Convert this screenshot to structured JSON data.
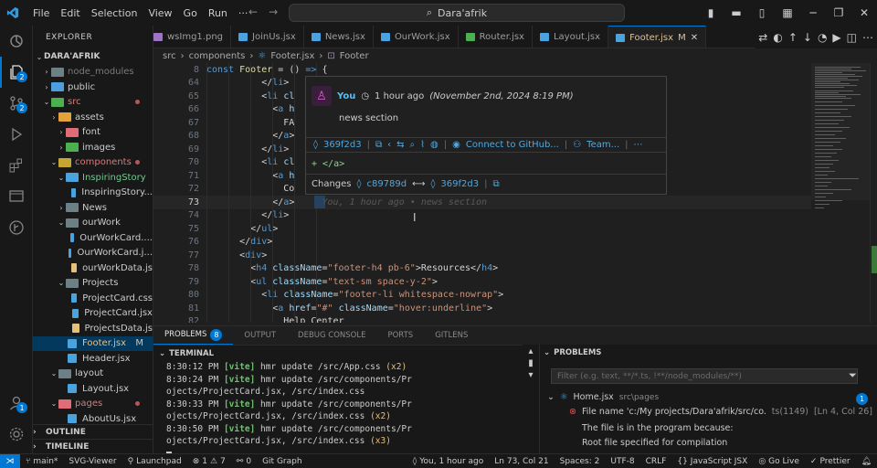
{
  "titlebar": {
    "menu": [
      "File",
      "Edit",
      "Selection",
      "View",
      "Go",
      "Run"
    ],
    "more": "···",
    "search": "Dara'afrik"
  },
  "activity": [
    {
      "icon": "vscode-logo-icon"
    },
    {
      "icon": "explorer-icon",
      "badge": "2"
    },
    {
      "icon": "source-control-icon",
      "badge": "2"
    },
    {
      "icon": "run-debug-icon"
    },
    {
      "icon": "extensions-icon"
    },
    {
      "icon": "remote-explorer-icon"
    },
    {
      "icon": "gitlens-icon"
    },
    {
      "icon": "accounts-icon",
      "badge": "1"
    },
    {
      "icon": "settings-gear-icon"
    }
  ],
  "sidebar": {
    "title": "EXPLORER",
    "root": "DARA'AFRIK",
    "items": [
      {
        "label": "node_modules",
        "indent": 1,
        "type": "folder",
        "open": false,
        "color": "#6d8086",
        "dim": true
      },
      {
        "label": "public",
        "indent": 1,
        "type": "folder",
        "open": false,
        "color": "#4d9de0"
      },
      {
        "label": "src",
        "indent": 1,
        "type": "folder",
        "open": true,
        "color": "#4caf50",
        "dot": true,
        "labelColor": "#d97a7a"
      },
      {
        "label": "assets",
        "indent": 2,
        "type": "folder",
        "open": false,
        "color": "#e5a23a"
      },
      {
        "label": "font",
        "indent": 3,
        "type": "folder",
        "open": false,
        "color": "#e06c75"
      },
      {
        "label": "images",
        "indent": 3,
        "type": "folder",
        "open": false,
        "color": "#4caf50"
      },
      {
        "label": "components",
        "indent": 2,
        "type": "folder",
        "open": true,
        "color": "#c5a632",
        "dot": true,
        "labelColor": "#d97a7a"
      },
      {
        "label": "InspiringStory",
        "indent": 3,
        "type": "folder",
        "open": true,
        "color": "#4aa3df",
        "labelColor": "#73c991"
      },
      {
        "label": "InspiringStory...",
        "indent": 4,
        "type": "file",
        "color": "#4aa3df"
      },
      {
        "label": "News",
        "indent": 3,
        "type": "folder",
        "open": false,
        "color": "#6d8086"
      },
      {
        "label": "ourWork",
        "indent": 3,
        "type": "folder",
        "open": true,
        "color": "#6d8086"
      },
      {
        "label": "OurWorkCard....",
        "indent": 4,
        "type": "file",
        "color": "#4aa3df"
      },
      {
        "label": "OurWorkCard.j...",
        "indent": 4,
        "type": "file",
        "color": "#4aa3df"
      },
      {
        "label": "ourWorkData.js",
        "indent": 4,
        "type": "file",
        "color": "#e5c07b"
      },
      {
        "label": "Projects",
        "indent": 3,
        "type": "folder",
        "open": true,
        "color": "#6d8086"
      },
      {
        "label": "ProjectCard.css",
        "indent": 4,
        "type": "file",
        "color": "#4aa3df"
      },
      {
        "label": "ProjectCard.jsx",
        "indent": 4,
        "type": "file",
        "color": "#4aa3df"
      },
      {
        "label": "ProjectsData.js",
        "indent": 4,
        "type": "file",
        "color": "#e5c07b"
      },
      {
        "label": "Footer.jsx",
        "indent": 3,
        "type": "file",
        "color": "#4aa3df",
        "mod": "M",
        "selected": true,
        "labelColor": "#e2c08d"
      },
      {
        "label": "Header.jsx",
        "indent": 3,
        "type": "file",
        "color": "#4aa3df"
      },
      {
        "label": "layout",
        "indent": 2,
        "type": "folder",
        "open": true,
        "color": "#6d8086"
      },
      {
        "label": "Layout.jsx",
        "indent": 3,
        "type": "file",
        "color": "#4aa3df"
      },
      {
        "label": "pages",
        "indent": 2,
        "type": "folder",
        "open": true,
        "color": "#e06c75",
        "dot": true,
        "labelColor": "#d97a7a"
      },
      {
        "label": "AboutUs.jsx",
        "indent": 3,
        "type": "file",
        "color": "#4aa3df"
      }
    ],
    "outline": "OUTLINE",
    "timeline": "TIMELINE"
  },
  "tabs": [
    {
      "label": "wsImg1.png",
      "color": "#a074c4"
    },
    {
      "label": "JoinUs.jsx",
      "color": "#4aa3df"
    },
    {
      "label": "News.jsx",
      "color": "#4aa3df"
    },
    {
      "label": "OurWork.jsx",
      "color": "#4aa3df"
    },
    {
      "label": "Router.jsx",
      "color": "#4caf50"
    },
    {
      "label": "Layout.jsx",
      "color": "#4aa3df"
    },
    {
      "label": "Footer.jsx",
      "color": "#4aa3df",
      "active": true,
      "mod": "M"
    }
  ],
  "breadcrumb": [
    "src",
    "components",
    "Footer.jsx",
    "Footer"
  ],
  "editor": {
    "lines": [
      {
        "n": "8",
        "html": "<span class='kw'>const</span> <span class='fn'>Footer</span> = () <span class='kw'>=&gt;</span> {"
      },
      {
        "n": "64",
        "html": "          &lt;/<span class='tag'>li</span>&gt;"
      },
      {
        "n": "65",
        "html": "          &lt;<span class='tag'>li</span> <span class='attr'>cl</span>"
      },
      {
        "n": "66",
        "html": "            &lt;<span class='tag'>a</span> <span class='attr'>h</span>"
      },
      {
        "n": "67",
        "html": "              FA"
      },
      {
        "n": "68",
        "html": "            &lt;/<span class='tag'>a</span>&gt;"
      },
      {
        "n": "69",
        "html": "          &lt;/<span class='tag'>li</span>&gt;"
      },
      {
        "n": "70",
        "html": "          &lt;<span class='tag'>li</span> <span class='attr'>cl</span>"
      },
      {
        "n": "71",
        "html": "            &lt;<span class='tag'>a</span> <span class='attr'>h</span>"
      },
      {
        "n": "72",
        "html": "              Co"
      },
      {
        "n": "73",
        "html": "            &lt;/<span class='tag'>a</span>&gt;     <span class='ghost'>You, 1 hour ago • news section</span>",
        "cur": true
      },
      {
        "n": "74",
        "html": "          &lt;/<span class='tag'>li</span>&gt;"
      },
      {
        "n": "75",
        "html": "        &lt;/<span class='tag'>ul</span>&gt;"
      },
      {
        "n": "76",
        "html": "      &lt;/<span class='tag'>div</span>&gt;"
      },
      {
        "n": "77",
        "html": "      &lt;<span class='tag'>div</span>&gt;"
      },
      {
        "n": "78",
        "html": "        &lt;<span class='tag'>h4</span> <span class='attr'>className</span>=<span class='str'>\"footer-h4 pb-6\"</span>&gt;Resources&lt;/<span class='tag'>h4</span>&gt;"
      },
      {
        "n": "79",
        "html": "        &lt;<span class='tag'>ul</span> <span class='attr'>className</span>=<span class='str'>\"text-sm space-y-2\"</span>&gt;"
      },
      {
        "n": "80",
        "html": "          &lt;<span class='tag'>li</span> <span class='attr'>className</span>=<span class='str'>\"footer-li whitespace-nowrap\"</span>&gt;"
      },
      {
        "n": "81",
        "html": "            &lt;<span class='tag'>a</span> <span class='attr'>href</span>=<span class='str'>\"#\"</span> <span class='attr'>className</span>=<span class='str'>\"hover:underline\"</span>&gt;"
      },
      {
        "n": "82",
        "html": "              Help Center"
      }
    ]
  },
  "hover": {
    "author": "You",
    "time": "1 hour ago",
    "date": "(November 2nd, 2024 8:19 PM)",
    "message": "news section",
    "sha": "369f2d3",
    "connect": "Connect to GitHub...",
    "team": "Team...",
    "diff": "+ </a>",
    "changes_label": "Changes",
    "from_sha": "c89789d",
    "to_sha": "369f2d3"
  },
  "panel_tabs": [
    {
      "label": "PROBLEMS",
      "badge": "8",
      "active": true
    },
    {
      "label": "OUTPUT"
    },
    {
      "label": "DEBUG CONSOLE"
    },
    {
      "label": "PORTS"
    },
    {
      "label": "GITLENS"
    }
  ],
  "terminal": {
    "title": "TERMINAL",
    "lines": [
      {
        "time": "8:30:12 PM",
        "tag": "[vite]",
        "text": "hmr update /src/App.css",
        "count": "(x2)"
      },
      {
        "time": "8:30:24 PM",
        "tag": "[vite]",
        "text": "hmr update /src/components/Pr",
        "count": ""
      },
      {
        "time": "",
        "tag": "",
        "text": "ojects/ProjectCard.jsx, /src/index.css",
        "count": ""
      },
      {
        "time": "8:30:33 PM",
        "tag": "[vite]",
        "text": "hmr update /src/components/Pr",
        "count": ""
      },
      {
        "time": "",
        "tag": "",
        "text": "ojects/ProjectCard.jsx, /src/index.css",
        "count": "(x2)"
      },
      {
        "time": "8:30:50 PM",
        "tag": "[vite]",
        "text": "hmr update /src/components/Pr",
        "count": ""
      },
      {
        "time": "",
        "tag": "",
        "text": "ojects/ProjectCard.jsx, /src/index.css",
        "count": "(x3)"
      }
    ]
  },
  "problems": {
    "title": "PROBLEMS",
    "filter_placeholder": "Filter (e.g. text, **/*.ts, !**/node_modules/**)",
    "file": "Home.jsx",
    "file_path": "src\\pages",
    "count": "1",
    "error_text": "File name 'c:/My projects/Dara'afrik/src/co...",
    "error_code": "ts(1149)",
    "error_pos": "[Ln 4, Col 26]",
    "desc1": "The file is in the program because:",
    "desc2": "Root file specified for compilation"
  },
  "status": {
    "branch": "main*",
    "svg_viewer": "SVG-Viewer",
    "launchpad": "Launchpad",
    "errors": "1",
    "warnings": "7",
    "ports": "0",
    "git_graph": "Git Graph",
    "blame": "You, 1 hour ago",
    "position": "Ln 73, Col 21",
    "spaces": "Spaces: 2",
    "encoding": "UTF-8",
    "eol": "CRLF",
    "language": "JavaScript JSX",
    "golive": "Go Live",
    "prettier": "Prettier"
  }
}
